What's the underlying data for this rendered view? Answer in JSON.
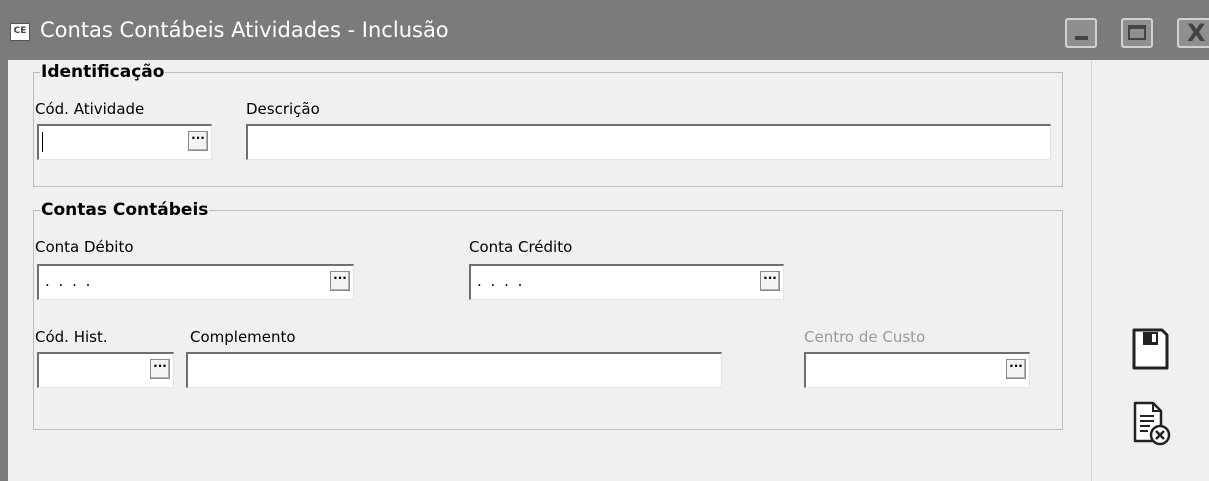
{
  "window": {
    "app_icon_text": "CE",
    "title": "Contas Contábeis Atividades - Inclusão",
    "close_glyph": "X"
  },
  "identificacao": {
    "legend": "Identificação",
    "cod_atividade_label": "Cód. Atividade",
    "cod_atividade_value": "",
    "descricao_label": "Descrição",
    "descricao_value": ""
  },
  "contas": {
    "legend": "Contas Contábeis",
    "debito_label": "Conta Débito",
    "debito_value": ". . . .",
    "credito_label": "Conta Crédito",
    "credito_value": ". . . .",
    "cod_hist_label": "Cód. Hist.",
    "cod_hist_value": "",
    "complemento_label": "Complemento",
    "complemento_value": "",
    "centro_custo_label": "Centro de Custo",
    "centro_custo_value": ""
  },
  "lookup_glyph": "···",
  "side_actions": {
    "save_icon": "floppy-disk-icon",
    "cancel_icon": "document-cancel-icon"
  },
  "colors": {
    "titlebar": "#7b7b7b",
    "panel": "#f0f0f0",
    "disabled_text": "#9a9a9a"
  }
}
